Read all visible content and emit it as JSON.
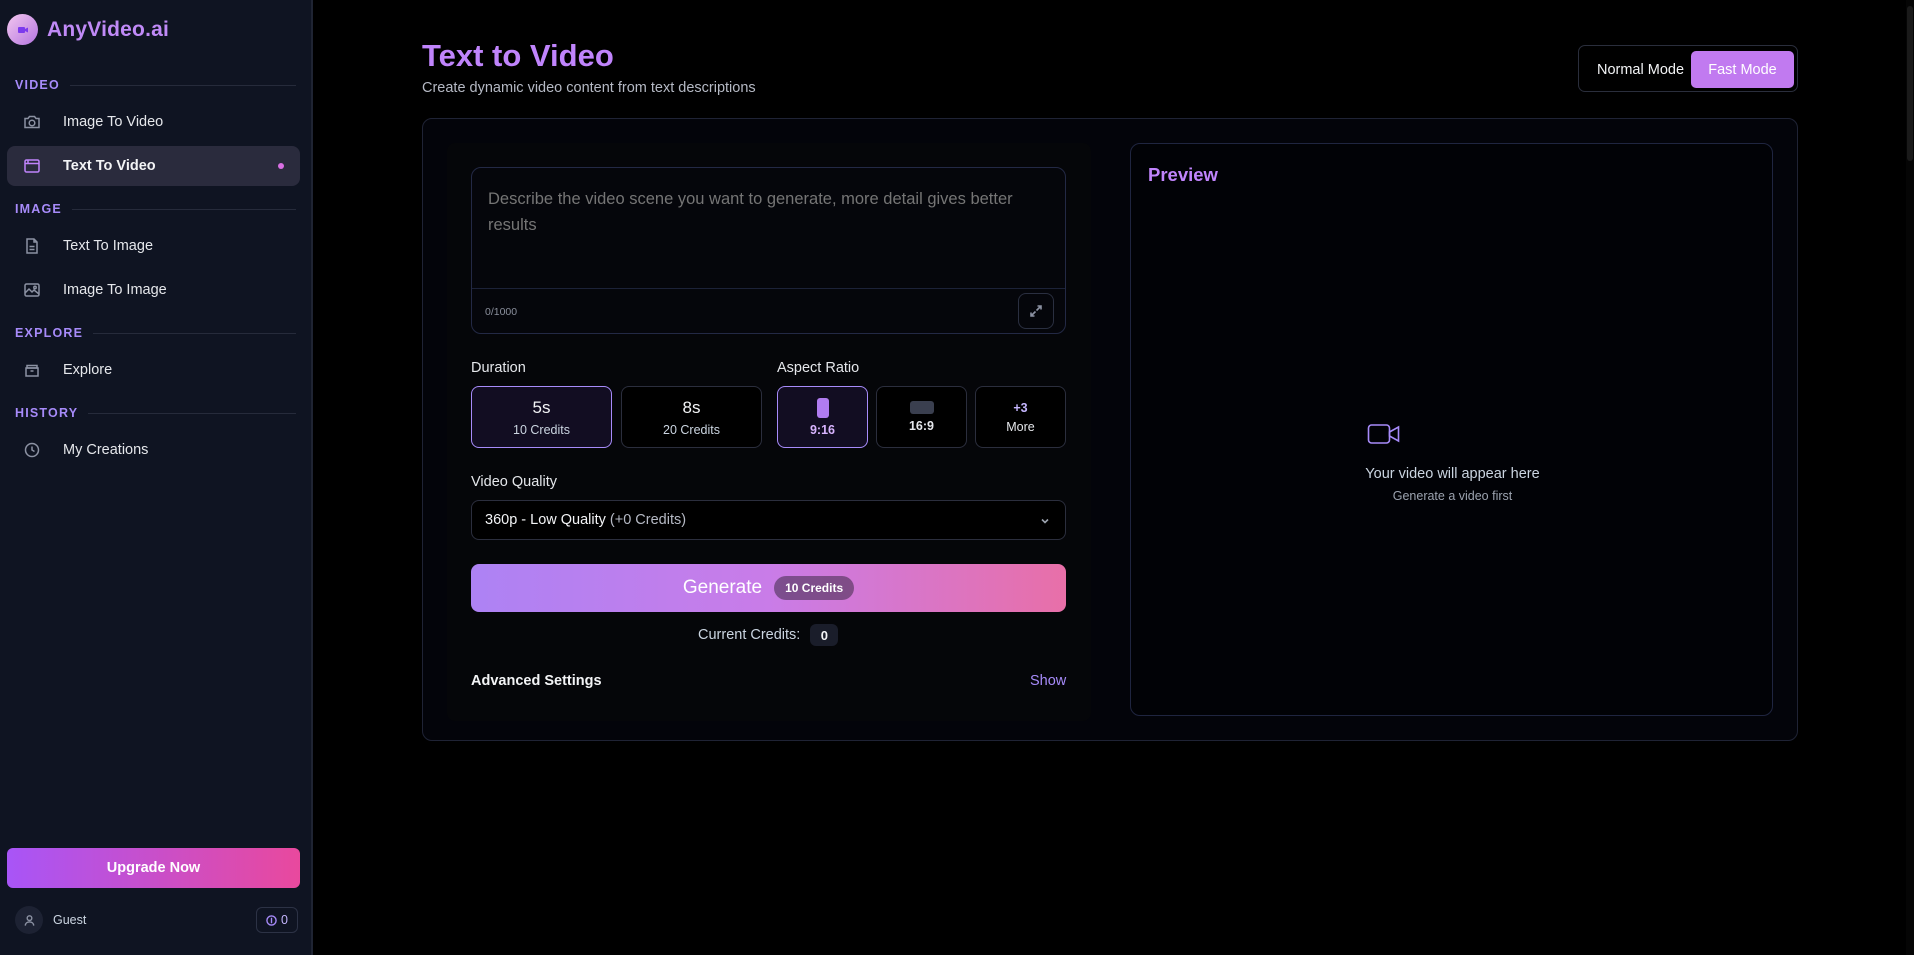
{
  "app": {
    "name": "AnyVideo.ai"
  },
  "sidebar": {
    "sections": [
      {
        "label": "VIDEO"
      },
      {
        "label": "IMAGE"
      },
      {
        "label": "EXPLORE"
      },
      {
        "label": "HISTORY"
      }
    ],
    "items": [
      {
        "label": "Image To Video",
        "icon": "camera-icon"
      },
      {
        "label": "Text To Video",
        "icon": "film-icon",
        "active": true
      },
      {
        "label": "Text To Image",
        "icon": "file-icon"
      },
      {
        "label": "Image To Image",
        "icon": "image-icon"
      },
      {
        "label": "Explore",
        "icon": "box-icon"
      },
      {
        "label": "My Creations",
        "icon": "clock-icon"
      }
    ],
    "upgrade_label": "Upgrade Now",
    "user": {
      "name": "Guest",
      "credits": "0"
    }
  },
  "header": {
    "title": "Text to Video",
    "subtitle": "Create dynamic video content from text descriptions",
    "modes": [
      "Normal Mode",
      "Fast Mode"
    ],
    "active_mode": "Fast Mode"
  },
  "form": {
    "prompt_placeholder": "Describe the video scene you want to generate, more detail gives better results",
    "char_count": "0/1000",
    "duration_label": "Duration",
    "durations": [
      {
        "value": "5s",
        "credits": "10 Credits",
        "selected": true
      },
      {
        "value": "8s",
        "credits": "20 Credits"
      }
    ],
    "aspect_label": "Aspect Ratio",
    "aspects": [
      {
        "label": "9:16",
        "selected": true
      },
      {
        "label": "16:9"
      },
      {
        "top": "+3",
        "label": "More"
      }
    ],
    "quality_label": "Video Quality",
    "quality_value": "360p - Low Quality",
    "quality_extra": "(+0 Credits)",
    "generate_label": "Generate",
    "generate_cost": "10 Credits",
    "current_credits_label": "Current Credits:",
    "current_credits_value": "0",
    "advanced_label": "Advanced Settings",
    "advanced_toggle": "Show"
  },
  "preview": {
    "title": "Preview",
    "icon": "video-camera-icon",
    "message": "Your video will appear here",
    "sub": "Generate a video first"
  },
  "colors": {
    "accent": "#c084fc",
    "gradient_start": "#a855f7",
    "gradient_end": "#ec4899"
  }
}
